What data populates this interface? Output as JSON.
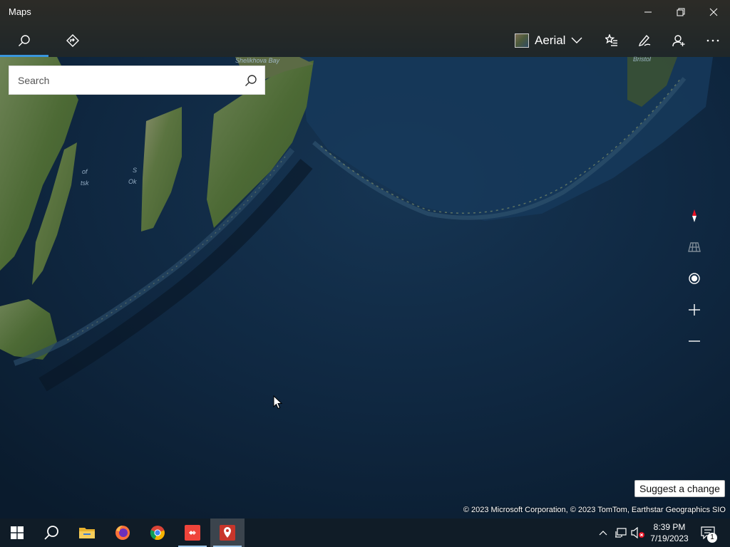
{
  "titlebar": {
    "app_title": "Maps",
    "controls": [
      "minimize",
      "restore",
      "close"
    ]
  },
  "toolbar": {
    "tabs": [
      {
        "name": "search",
        "icon": "search-icon",
        "selected": true
      },
      {
        "name": "directions",
        "icon": "directions-icon",
        "selected": false
      }
    ],
    "map_style": {
      "label": "Aerial",
      "icon": "aerial-thumbnail"
    },
    "actions": [
      "favorites-icon",
      "ink-pen-icon",
      "account-icon",
      "more-icon"
    ]
  },
  "search": {
    "placeholder": "Search",
    "value": ""
  },
  "map": {
    "view": "Aerial",
    "labels": [
      "Shelikhova Bay",
      "Bristol",
      "of",
      "tsk",
      "S",
      "Ok"
    ],
    "controls": [
      "compass-icon",
      "tilt-3d-icon",
      "my-location-icon",
      "zoom-in-icon",
      "zoom-out-icon"
    ]
  },
  "footer": {
    "suggest_label": "Suggest a change",
    "copyright": "© 2023 Microsoft Corporation, © 2023 TomTom, Earthstar Geographics  SIO"
  },
  "taskbar": {
    "apps": [
      {
        "name": "Start",
        "icon": "windows-start-icon"
      },
      {
        "name": "Search",
        "icon": "search-icon"
      },
      {
        "name": "File Explorer",
        "icon": "folder-icon"
      },
      {
        "name": "Firefox",
        "icon": "firefox-icon"
      },
      {
        "name": "Chrome",
        "icon": "chrome-icon"
      },
      {
        "name": "AnyDesk",
        "icon": "anydesk-icon"
      },
      {
        "name": "Maps",
        "icon": "maps-icon",
        "active": true
      }
    ],
    "tray": {
      "time": "8:39 PM",
      "date": "7/19/2023",
      "notification_count": "1"
    }
  },
  "colors": {
    "accent": "#3a96dd",
    "ocean": "#0e2236",
    "land": "#4f6b3a",
    "taskbar": "#101c27"
  }
}
